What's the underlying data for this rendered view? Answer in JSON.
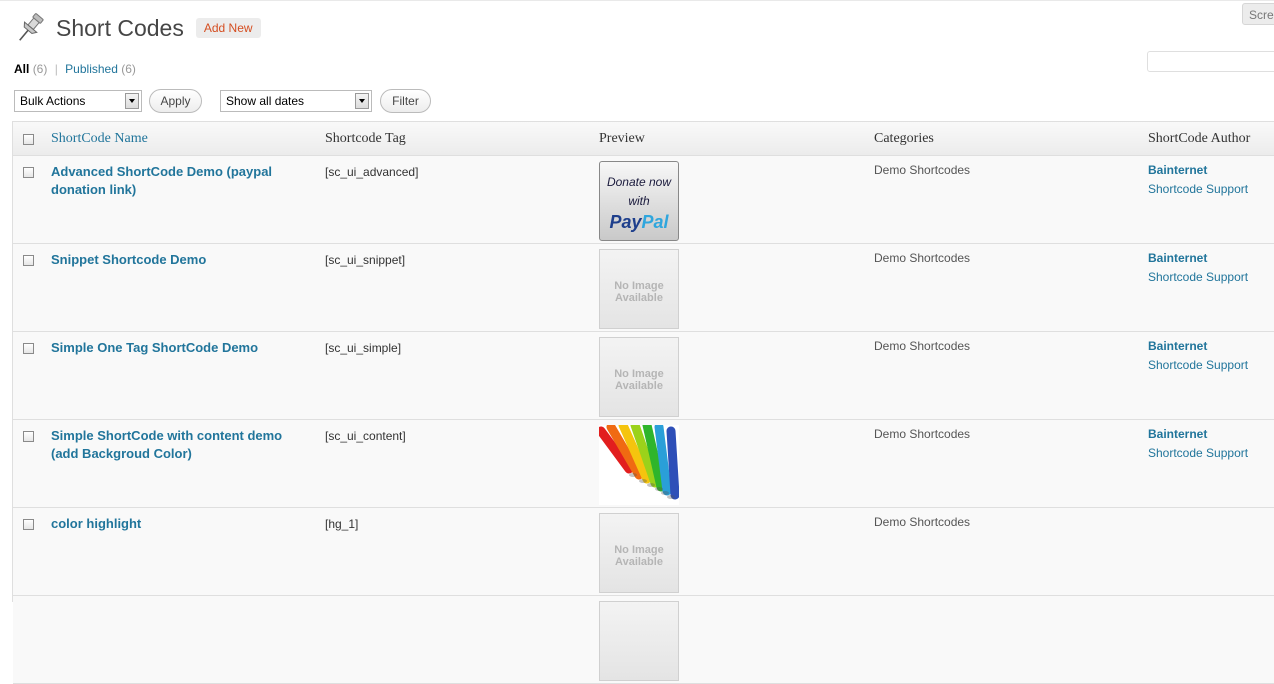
{
  "header": {
    "title": "Short Codes",
    "add_new": "Add New",
    "screen_options": "Screen Options"
  },
  "views": {
    "all_label": "All",
    "all_count": "(6)",
    "published_label": "Published",
    "published_count": "(6)",
    "separator": "|"
  },
  "filters": {
    "bulk_actions": "Bulk Actions",
    "apply": "Apply",
    "dates": "Show all dates",
    "filter": "Filter"
  },
  "table": {
    "columns": [
      "ShortCode Name",
      "Shortcode Tag",
      "Preview",
      "Categories",
      "ShortCode Author"
    ],
    "rows": [
      {
        "title": "Advanced ShortCode Demo (paypal donation link)",
        "tag": "[sc_ui_advanced]",
        "preview": "paypal",
        "preview_text": "Donate now with",
        "preview_brand_a": "Pay",
        "preview_brand_b": "Pal",
        "category": "Demo Shortcodes",
        "author": "Bainternet",
        "support": "Shortcode Support"
      },
      {
        "title": "Snippet Shortcode Demo",
        "tag": "[sc_ui_snippet]",
        "preview": "none",
        "preview_text": "No Image Available",
        "category": "Demo Shortcodes",
        "author": "Bainternet",
        "support": "Shortcode Support"
      },
      {
        "title": "Simple One Tag ShortCode Demo",
        "tag": "[sc_ui_simple]",
        "preview": "none",
        "preview_text": "No Image Available",
        "category": "Demo Shortcodes",
        "author": "Bainternet",
        "support": "Shortcode Support"
      },
      {
        "title": "Simple ShortCode with content demo (add Backgroud Color)",
        "tag": "[sc_ui_content]",
        "preview": "crayons",
        "category": "Demo Shortcodes",
        "author": "Bainternet",
        "support": "Shortcode Support"
      },
      {
        "title": "color highlight",
        "tag": "[hg_1]",
        "preview": "none",
        "preview_text": "No Image Available",
        "category": "Demo Shortcodes",
        "author": "",
        "support": ""
      }
    ]
  },
  "colors": {
    "link": "#21759b",
    "add_new_text": "#d54e21"
  }
}
